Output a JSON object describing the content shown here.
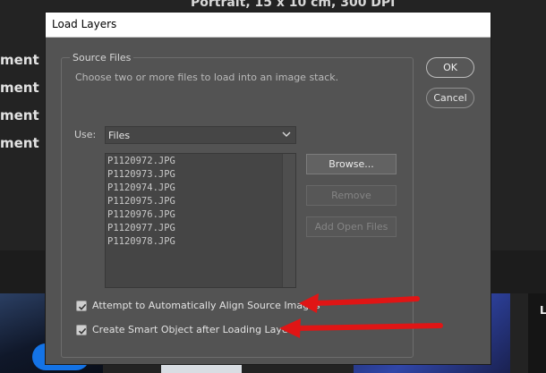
{
  "background": {
    "top_text": "Portrait, 15 x 10 cm, 300 DPI",
    "left_labels": [
      "ment",
      "ment",
      "ment",
      "ment"
    ],
    "right_letter": "L"
  },
  "dialog": {
    "title": "Load Layers",
    "group_label": "Source Files",
    "description": "Choose two or more files to load into an image stack.",
    "use_label": "Use:",
    "use_select": {
      "value": "Files"
    },
    "files": [
      "P1120972.JPG",
      "P1120973.JPG",
      "P1120974.JPG",
      "P1120975.JPG",
      "P1120976.JPG",
      "P1120977.JPG",
      "P1120978.JPG"
    ],
    "buttons": {
      "browse": "Browse...",
      "remove": "Remove",
      "add_open": "Add Open Files",
      "ok": "OK",
      "cancel": "Cancel"
    },
    "checkboxes": [
      {
        "label": "Attempt to Automatically Align Source Images",
        "checked": true
      },
      {
        "label": "Create Smart Object after Loading Layers",
        "checked": true
      }
    ]
  },
  "colors": {
    "dialog_bg": "#535353",
    "annotation_arrow": "#e01515",
    "accent_blue": "#1473e6"
  }
}
